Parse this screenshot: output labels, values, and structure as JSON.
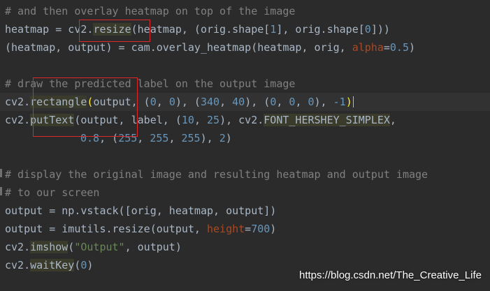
{
  "editor": {
    "colors": {
      "background": "#2b2b2b",
      "text": "#a9b7c6",
      "comment": "#808080",
      "number": "#6897bb",
      "string": "#6a8759",
      "keyword_arg": "#aa4926",
      "usage_highlight": "#3b3b2c",
      "annotation_box": "#e0272a"
    },
    "lines": [
      {
        "id": "l1",
        "tokens": [
          {
            "t": "# and then overlay heatmap on top of the image",
            "c": "c"
          }
        ]
      },
      {
        "id": "l2",
        "tokens": [
          {
            "t": "heatmap = cv2."
          },
          {
            "t": "resize",
            "hl": true
          },
          {
            "t": "(heatmap, (orig.shape["
          },
          {
            "t": "1",
            "c": "n"
          },
          {
            "t": "], orig.shape["
          },
          {
            "t": "0",
            "c": "n"
          },
          {
            "t": "]))"
          }
        ]
      },
      {
        "id": "l3",
        "tokens": [
          {
            "t": "(heatmap, output) = cam.overlay_heatmap(heatmap, orig, "
          },
          {
            "t": "alpha",
            "c": "k"
          },
          {
            "t": "="
          },
          {
            "t": "0.5",
            "c": "n"
          },
          {
            "t": ")"
          }
        ]
      },
      {
        "id": "l4",
        "tokens": []
      },
      {
        "id": "l5",
        "tokens": [
          {
            "t": "# draw the predicted label on the output image",
            "c": "c"
          }
        ]
      },
      {
        "id": "l6",
        "caret": true,
        "tokens": [
          {
            "t": "cv2."
          },
          {
            "t": "rectangle",
            "hl": true
          },
          {
            "t": "(",
            "c": "mc"
          },
          {
            "t": "output, ("
          },
          {
            "t": "0",
            "c": "n"
          },
          {
            "t": ", "
          },
          {
            "t": "0",
            "c": "n"
          },
          {
            "t": "), ("
          },
          {
            "t": "340",
            "c": "n"
          },
          {
            "t": ", "
          },
          {
            "t": "40",
            "c": "n"
          },
          {
            "t": "), ("
          },
          {
            "t": "0",
            "c": "n"
          },
          {
            "t": ", "
          },
          {
            "t": "0",
            "c": "n"
          },
          {
            "t": ", "
          },
          {
            "t": "0",
            "c": "n"
          },
          {
            "t": "), "
          },
          {
            "t": "-1",
            "c": "n"
          },
          {
            "t": ")",
            "c": "mc"
          }
        ]
      },
      {
        "id": "l7",
        "tokens": [
          {
            "t": "cv2."
          },
          {
            "t": "putText",
            "hl": true
          },
          {
            "t": "(output, label, ("
          },
          {
            "t": "10",
            "c": "n"
          },
          {
            "t": ", "
          },
          {
            "t": "25",
            "c": "n"
          },
          {
            "t": "), cv2."
          },
          {
            "t": "FONT_HERSHEY_SIMPLEX",
            "hl": true
          },
          {
            "t": ","
          }
        ]
      },
      {
        "id": "l8",
        "indent": true,
        "tokens": [
          {
            "t": "0.8",
            "c": "n"
          },
          {
            "t": ", ("
          },
          {
            "t": "255",
            "c": "n"
          },
          {
            "t": ", "
          },
          {
            "t": "255",
            "c": "n"
          },
          {
            "t": ", "
          },
          {
            "t": "255",
            "c": "n"
          },
          {
            "t": "), "
          },
          {
            "t": "2",
            "c": "n"
          },
          {
            "t": ")"
          }
        ]
      },
      {
        "id": "l9",
        "tokens": []
      },
      {
        "id": "l10",
        "tokens": [
          {
            "t": "# display the original image and resulting heatmap and output image",
            "c": "c"
          }
        ]
      },
      {
        "id": "l11",
        "tokens": [
          {
            "t": "# to our screen",
            "c": "c"
          }
        ]
      },
      {
        "id": "l12",
        "tokens": [
          {
            "t": "output = np.vstack([orig, heatmap, output])"
          }
        ]
      },
      {
        "id": "l13",
        "tokens": [
          {
            "t": "output = imutils.resize(output, "
          },
          {
            "t": "height",
            "c": "k"
          },
          {
            "t": "="
          },
          {
            "t": "700",
            "c": "n"
          },
          {
            "t": ")"
          }
        ]
      },
      {
        "id": "l14",
        "tokens": [
          {
            "t": "cv2."
          },
          {
            "t": "imshow",
            "hl": true
          },
          {
            "t": "("
          },
          {
            "t": "\"Output\"",
            "c": "s"
          },
          {
            "t": ", output)"
          }
        ]
      },
      {
        "id": "l15",
        "tokens": [
          {
            "t": "cv2."
          },
          {
            "t": "waitKey",
            "hl": true
          },
          {
            "t": "("
          },
          {
            "t": "0",
            "c": "n"
          },
          {
            "t": ")"
          }
        ]
      }
    ]
  },
  "watermark": {
    "text": "https://blog.csdn.net/The_Creative_Life"
  }
}
